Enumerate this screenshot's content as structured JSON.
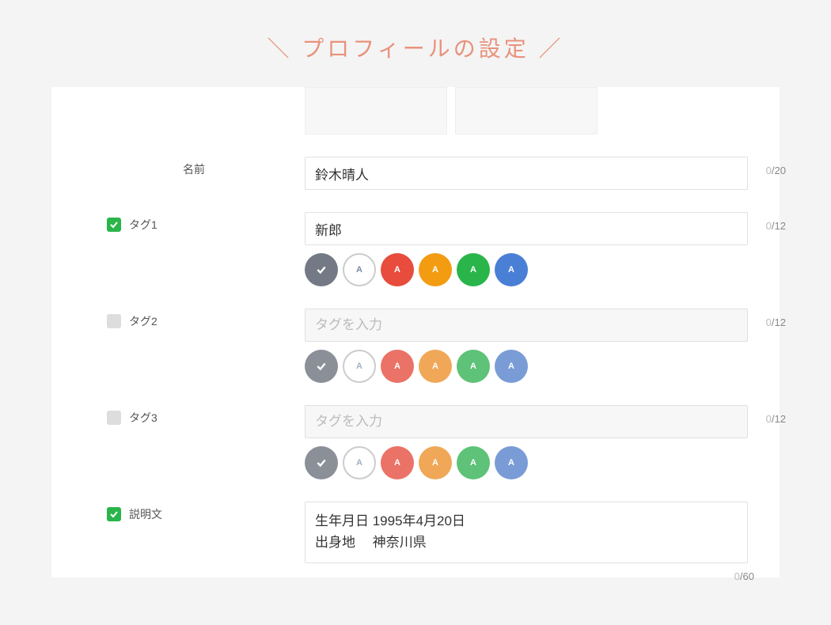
{
  "title": "＼ プロフィールの設定 ／",
  "fields": {
    "name": {
      "label": "名前",
      "value": "鈴木晴人",
      "count": "0",
      "max": "20"
    },
    "tag1": {
      "label": "タグ1",
      "checked": true,
      "value": "新郎",
      "placeholder": "タグを入力",
      "count": "0",
      "max": "12"
    },
    "tag2": {
      "label": "タグ2",
      "checked": false,
      "value": "",
      "placeholder": "タグを入力",
      "count": "0",
      "max": "12"
    },
    "tag3": {
      "label": "タグ3",
      "checked": false,
      "value": "",
      "placeholder": "タグを入力",
      "count": "0",
      "max": "12"
    },
    "description": {
      "label": "説明文",
      "checked": true,
      "value": "生年月日 1995年4月20日\n出身地　 神奈川県",
      "count": "0",
      "max": "60"
    }
  },
  "colors": {
    "gray": "#747a85",
    "outlineText": "#7a8aa8",
    "red": "#e74c3c",
    "orange": "#f39c12",
    "green": "#2ab54a",
    "blue": "#4a7fd6",
    "fadedRed": "#ea7266",
    "fadedOrange": "#f0a858",
    "fadedGreen": "#5ec278",
    "fadedBlue": "#7a9cd6"
  },
  "glyphs": {
    "A": "A"
  }
}
